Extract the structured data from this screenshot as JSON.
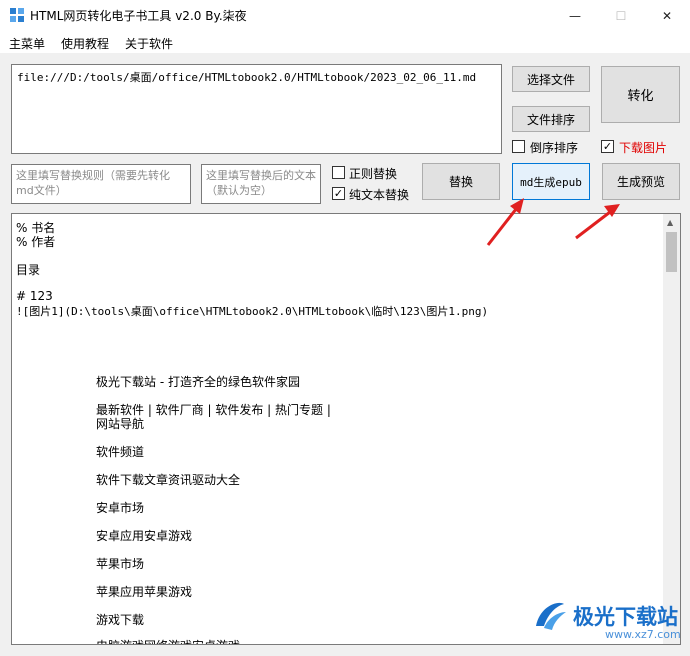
{
  "window": {
    "title": "HTML网页转化电子书工具 v2.0 By.柒夜",
    "minimize": "—",
    "maximize": "☐",
    "close": "✕"
  },
  "menu": {
    "items": [
      "主菜单",
      "使用教程",
      "关于软件"
    ]
  },
  "file_path": "file:///D:/tools/桌面/office/HTMLtobook2.0/HTMLtobook/2023_02_06_11.md",
  "buttons": {
    "select_file": "选择文件",
    "sort_files": "文件排序",
    "convert": "转化",
    "replace": "替换",
    "md_to_epub": "md生成epub",
    "preview": "生成预览"
  },
  "checkboxes": {
    "reverse_sort": {
      "label": "倒序排序",
      "checked": false
    },
    "download_images": {
      "label": "下载图片",
      "checked": true
    },
    "regex_replace": {
      "label": "正则替换",
      "checked": false
    },
    "plain_text_replace": {
      "label": "纯文本替换",
      "checked": true
    }
  },
  "replace_rule_placeholder": "这里填写替换规则（需要先转化md文件）",
  "replace_result_placeholder": "这里填写替换后的文本（默认为空）",
  "content_lines": {
    "l1": "% 书名",
    "l2": "% 作者",
    "l3": "目录",
    "l4": "# 123",
    "l5": "![图片1](D:\\tools\\桌面\\office\\HTMLtobook2.0\\HTMLtobook\\临时\\123\\图片1.png)"
  },
  "content_body": [
    "极光下载站 - 打造齐全的绿色软件家园",
    "最新软件 | 软件厂商 | 软件发布 | 热门专题 |",
    "网站导航",
    "软件频道",
    "软件下载文章资讯驱动大全",
    "安卓市场",
    "安卓应用安卓游戏",
    "苹果市场",
    "苹果应用苹果游戏",
    "游戏下载",
    "电脑游戏网络游戏安卓游戏"
  ],
  "watermark": {
    "name": "极光下载站",
    "url": "www.xz7.com"
  },
  "colors": {
    "accent": "#0078d7",
    "arrow": "#e02020",
    "download_label": "#e00000"
  }
}
